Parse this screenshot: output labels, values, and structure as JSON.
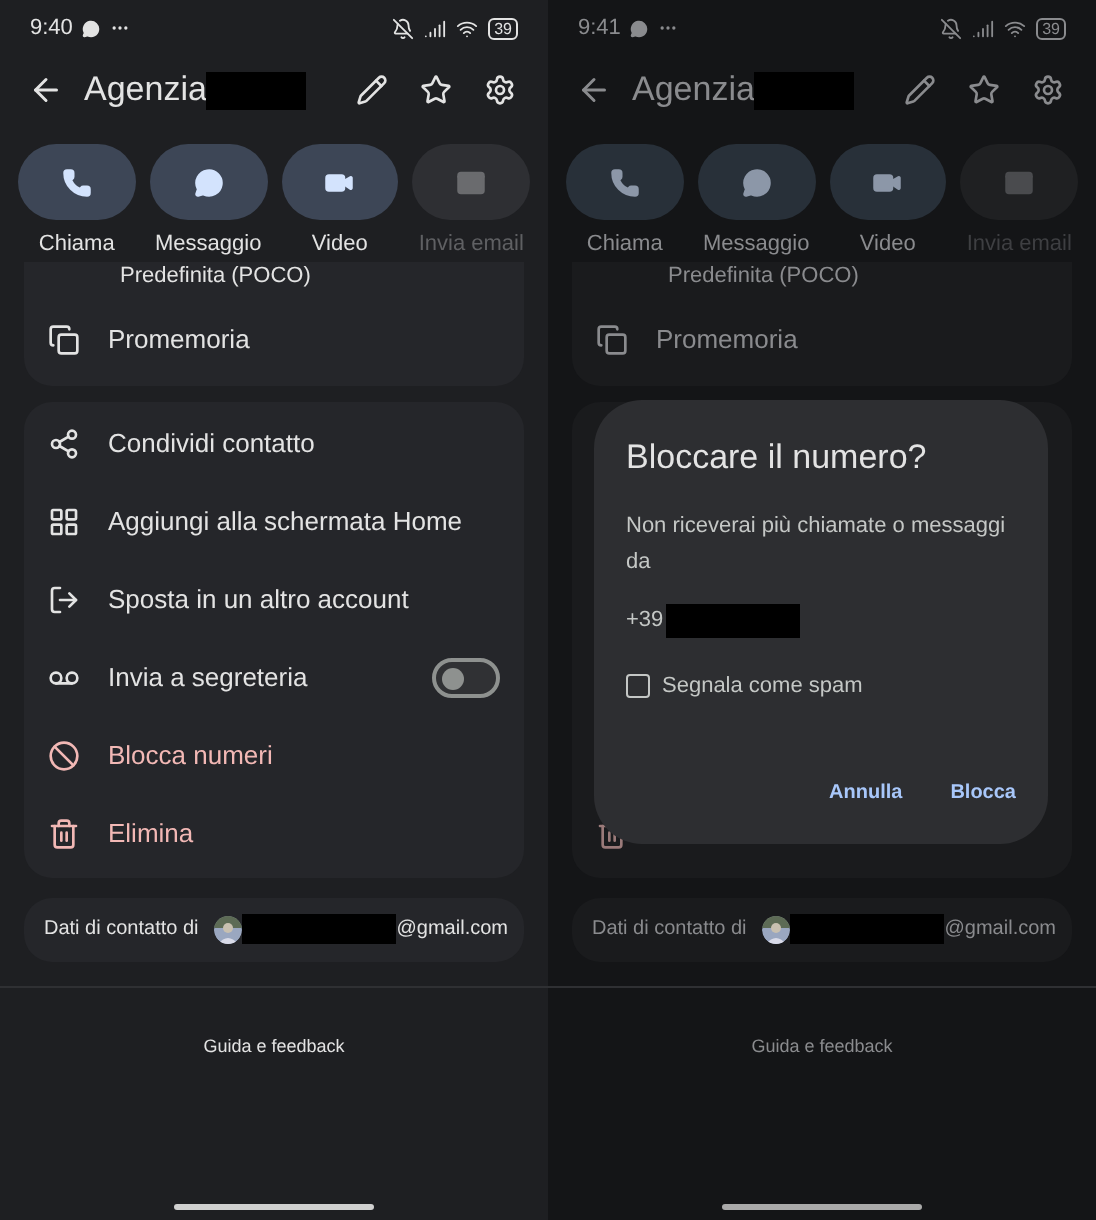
{
  "screens": [
    {
      "status_bar": {
        "time": "9:40",
        "battery": "39"
      },
      "header": {
        "title": "Agenzia"
      },
      "actions": [
        {
          "label": "Chiama",
          "disabled": false
        },
        {
          "label": "Messaggio",
          "disabled": false
        },
        {
          "label": "Video",
          "disabled": false
        },
        {
          "label": "Invia email",
          "disabled": true
        }
      ],
      "card_1": [
        {
          "label": "Predefinita (POCO)"
        },
        {
          "label": "Promemoria"
        }
      ],
      "menu": [
        {
          "label": "Condividi contatto",
          "kind": "plain"
        },
        {
          "label": "Aggiungi alla schermata Home",
          "kind": "plain"
        },
        {
          "label": "Sposta in un altro account",
          "kind": "plain"
        },
        {
          "label": "Invia a segreteria",
          "kind": "toggle",
          "on": false
        },
        {
          "label": "Blocca numeri",
          "kind": "danger"
        },
        {
          "label": "Elimina",
          "kind": "danger"
        }
      ],
      "contact_info": {
        "label": "Dati di contatto di",
        "email_suffix": "@gmail.com"
      },
      "footer_link": "Guida e feedback"
    },
    {
      "status_bar": {
        "time": "9:41",
        "battery": "39"
      },
      "header": {
        "title": "Agenzia"
      },
      "actions": [
        {
          "label": "Chiama",
          "disabled": false
        },
        {
          "label": "Messaggio",
          "disabled": false
        },
        {
          "label": "Video",
          "disabled": false
        },
        {
          "label": "Invia email",
          "disabled": true
        }
      ],
      "card_1": [
        {
          "label": "Predefinita (POCO)"
        },
        {
          "label": "Promemoria"
        }
      ],
      "dialog": {
        "title": "Bloccare il numero?",
        "message": "Non riceverai più chiamate o messaggi da",
        "number_prefix": "+39",
        "checkbox": {
          "label": "Segnala come spam",
          "checked": false
        },
        "buttons": [
          "Annulla",
          "Blocca"
        ]
      },
      "contact_info": {
        "label": "Dati di contatto di",
        "email_suffix": "@gmail.com"
      },
      "footer_link": "Guida e feedback"
    }
  ]
}
